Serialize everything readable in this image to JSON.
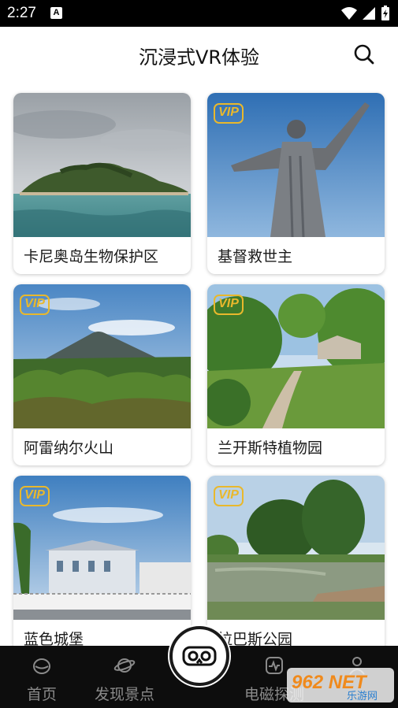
{
  "status": {
    "time": "2:27",
    "notification_letter": "A"
  },
  "header": {
    "title": "沉浸式VR体验",
    "search_icon": "search-icon"
  },
  "cards": [
    {
      "label": "卡尼奥岛生物保护区",
      "vip": false,
      "badge": ""
    },
    {
      "label": "基督救世主",
      "vip": true,
      "badge": "VIP"
    },
    {
      "label": "阿雷纳尔火山",
      "vip": true,
      "badge": "VIP"
    },
    {
      "label": "兰开斯特植物园",
      "vip": true,
      "badge": "VIP"
    },
    {
      "label": "蓝色城堡",
      "vip": true,
      "badge": "VIP"
    },
    {
      "label": "拉巴斯公园",
      "vip": true,
      "badge": "VIP"
    }
  ],
  "nav": {
    "items": [
      {
        "label": "首页",
        "icon": "home-icon"
      },
      {
        "label": "发现景点",
        "icon": "planet-icon"
      },
      {
        "label": "电磁探测",
        "icon": "pulse-icon"
      },
      {
        "label": "",
        "icon": "profile-icon"
      }
    ],
    "center_icon": "vr-headset-icon"
  },
  "watermark": {
    "text": "962 NET",
    "sub": "乐游网"
  },
  "colors": {
    "vip_gold": "#e9b82c",
    "nav_bg": "#0d0d0d",
    "nav_text": "#8a8a8a"
  }
}
